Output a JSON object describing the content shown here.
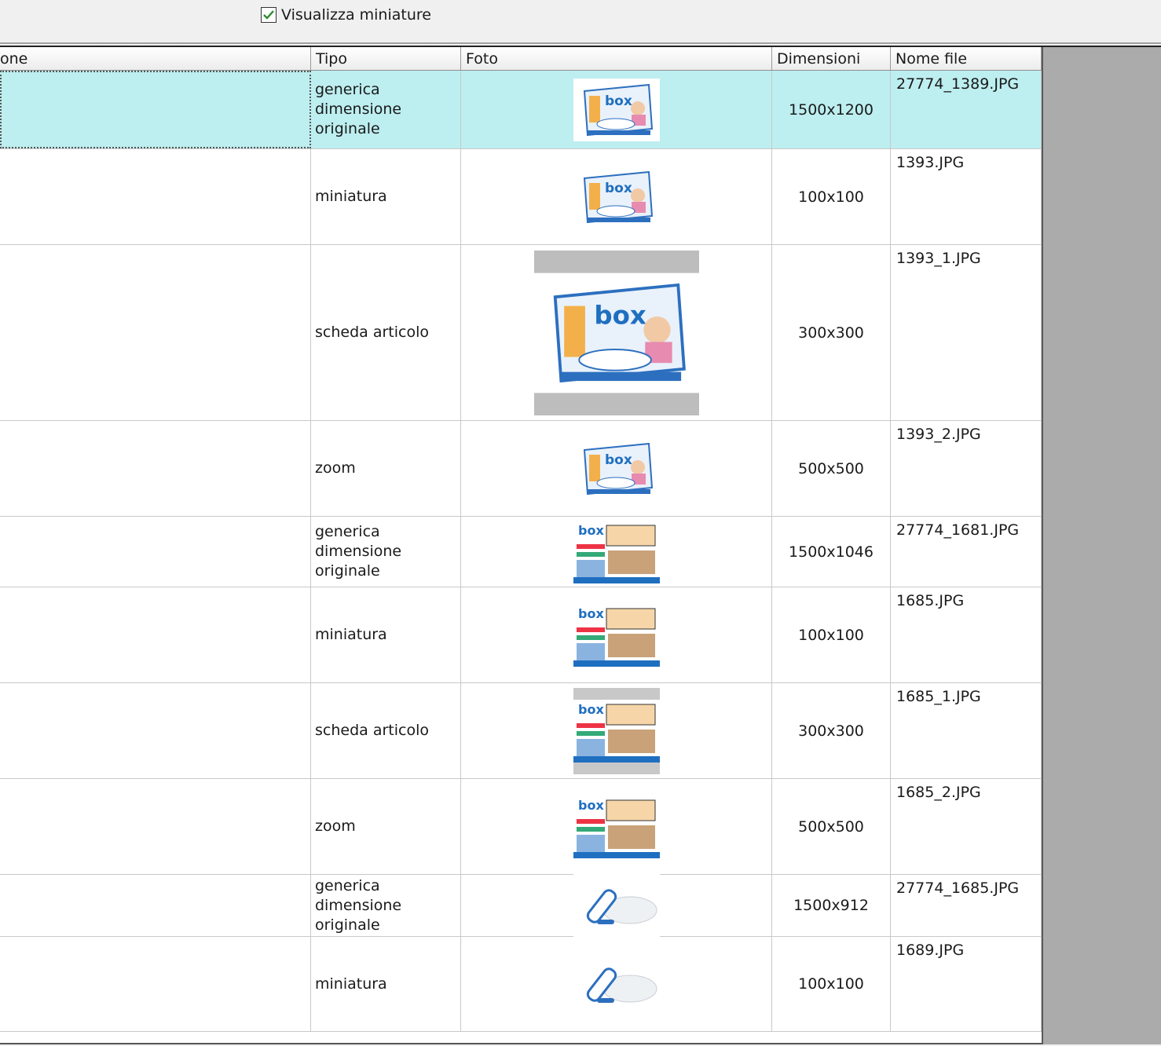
{
  "toolbar": {
    "show_thumbnails_label": "Visualizza miniature",
    "show_thumbnails_checked": true
  },
  "table": {
    "columns": [
      "one",
      "Tipo",
      "Foto",
      "Dimensioni",
      "Nome file"
    ],
    "rows": [
      {
        "tipo": "generica dimensione originale",
        "dimensioni": "1500x1200",
        "nome_file": "27774_1389.JPG",
        "selected": true,
        "photo": "box-product"
      },
      {
        "tipo": "miniatura",
        "dimensioni": "100x100",
        "nome_file": "1393.JPG",
        "photo": "box-product"
      },
      {
        "tipo": "scheda articolo",
        "dimensioni": "300x300",
        "nome_file": "1393_1.JPG",
        "photo": "box-product"
      },
      {
        "tipo": "zoom",
        "dimensioni": "500x500",
        "nome_file": "1393_2.JPG",
        "photo": "box-product"
      },
      {
        "tipo": "generica dimensione originale",
        "dimensioni": "1500x1046",
        "nome_file": "27774_1681.JPG",
        "photo": "box-collage"
      },
      {
        "tipo": "miniatura",
        "dimensioni": "100x100",
        "nome_file": "1685.JPG",
        "photo": "box-collage"
      },
      {
        "tipo": "scheda articolo",
        "dimensioni": "300x300",
        "nome_file": "1685_1.JPG",
        "photo": "box-collage"
      },
      {
        "tipo": "zoom",
        "dimensioni": "500x500",
        "nome_file": "1685_2.JPG",
        "photo": "box-collage"
      },
      {
        "tipo": "generica dimensione originale",
        "dimensioni": "1500x912",
        "nome_file": "27774_1685.JPG",
        "photo": "pen-device"
      },
      {
        "tipo": "miniatura",
        "dimensioni": "100x100",
        "nome_file": "1689.JPG",
        "photo": "pen-device"
      }
    ]
  },
  "colors": {
    "selection": "#bdeef0",
    "panel": "#f0f0f0",
    "side_gray": "#ababab",
    "check": "#2e8b2e"
  }
}
